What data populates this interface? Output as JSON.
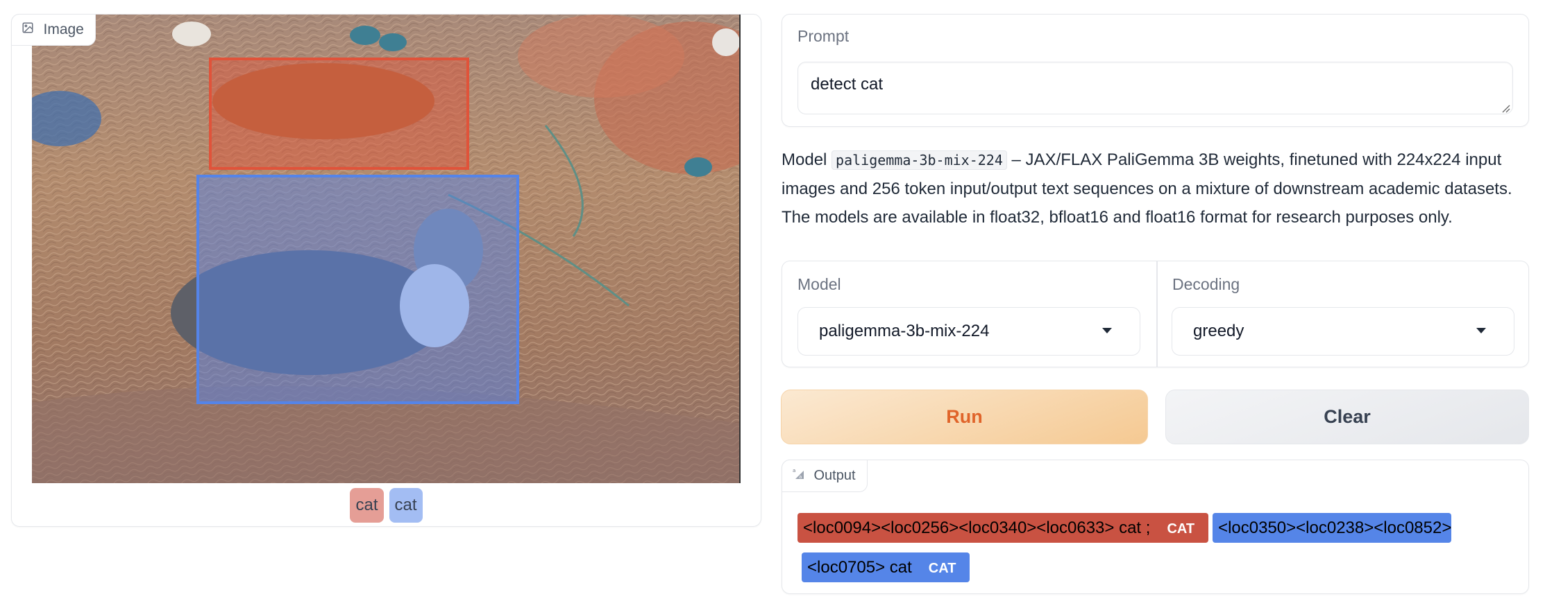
{
  "image_block": {
    "label": "Image",
    "label_icon": "image-icon",
    "detections": [
      {
        "label": "cat",
        "color": "#e0533a",
        "fill": "rgba(224,83,58,0.45)",
        "legend_bg": "#e59e96",
        "loc": [
          "0094",
          "0256",
          "0340",
          "0633"
        ]
      },
      {
        "label": "cat",
        "color": "#5584e8",
        "fill": "rgba(85,132,232,0.5)",
        "legend_bg": "#a3bdf3",
        "loc": [
          "0350",
          "0238",
          "0852",
          "0705"
        ]
      }
    ]
  },
  "prompt": {
    "label": "Prompt",
    "value": "detect cat",
    "placeholder": ""
  },
  "description": {
    "prefix": "Model",
    "model_code": "paligemma-3b-mix-224",
    "text": " – JAX/FLAX PaliGemma 3B weights, finetuned with 224x224 input images and 256 token input/output text sequences on a mixture of downstream academic datasets. The models are available in float32, bfloat16 and float16 format for research purposes only."
  },
  "options": {
    "model": {
      "label": "Model",
      "value": "paligemma-3b-mix-224"
    },
    "decoding": {
      "label": "Decoding",
      "value": "greedy"
    }
  },
  "buttons": {
    "run": "Run",
    "clear": "Clear"
  },
  "output": {
    "label": "Output",
    "label_icon": "text-highlight-icon",
    "segments": [
      {
        "text": "<loc0094><loc0256><loc0340><loc0633> cat ;",
        "tag": "CAT",
        "color": "#c95242"
      },
      {
        "text": "<loc0350><loc0238><loc0852><loc0705> cat",
        "tag": "CAT",
        "color": "#5585e8"
      }
    ]
  }
}
